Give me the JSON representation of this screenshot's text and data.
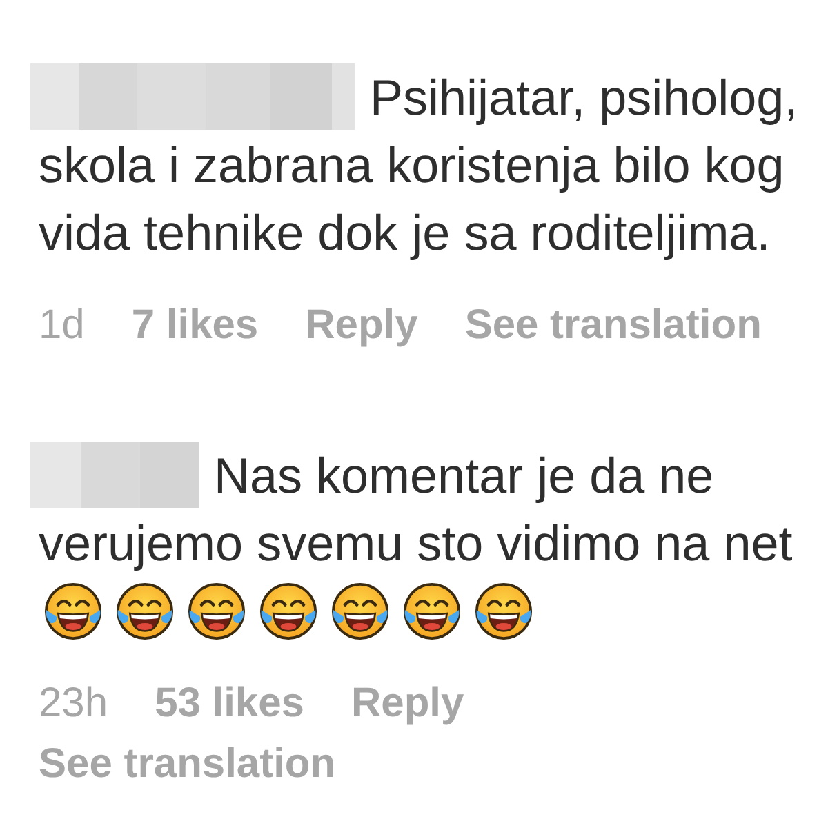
{
  "comments": [
    {
      "author": {
        "blurred": true
      },
      "text": "Psihijatar, psiholog, skola i zabrana koristenja bilo kog vida tehnike dok je sa roditeljima.",
      "footer": [
        [
          {
            "kind": "time",
            "text": "1d"
          },
          {
            "kind": "likes",
            "text": "7 likes"
          },
          {
            "kind": "reply",
            "text": "Reply"
          },
          {
            "kind": "translate",
            "text": "See translation"
          }
        ]
      ]
    },
    {
      "author": {
        "blurred": true
      },
      "text": "Nas komentar je da ne verujemo svemu sto vidimo na net",
      "emoji": [
        {
          "kind": "tears-of-joy"
        },
        {
          "kind": "tears-of-joy"
        },
        {
          "kind": "tears-of-joy"
        },
        {
          "kind": "tears-of-joy"
        },
        {
          "kind": "tears-of-joy"
        },
        {
          "kind": "tears-of-joy"
        },
        {
          "kind": "tears-of-joy"
        }
      ],
      "footer": [
        [
          {
            "kind": "time",
            "text": "23h"
          },
          {
            "kind": "likes",
            "text": "53 likes"
          },
          {
            "kind": "reply",
            "text": "Reply"
          }
        ],
        [
          {
            "kind": "translate",
            "text": "See translation"
          }
        ]
      ]
    }
  ]
}
